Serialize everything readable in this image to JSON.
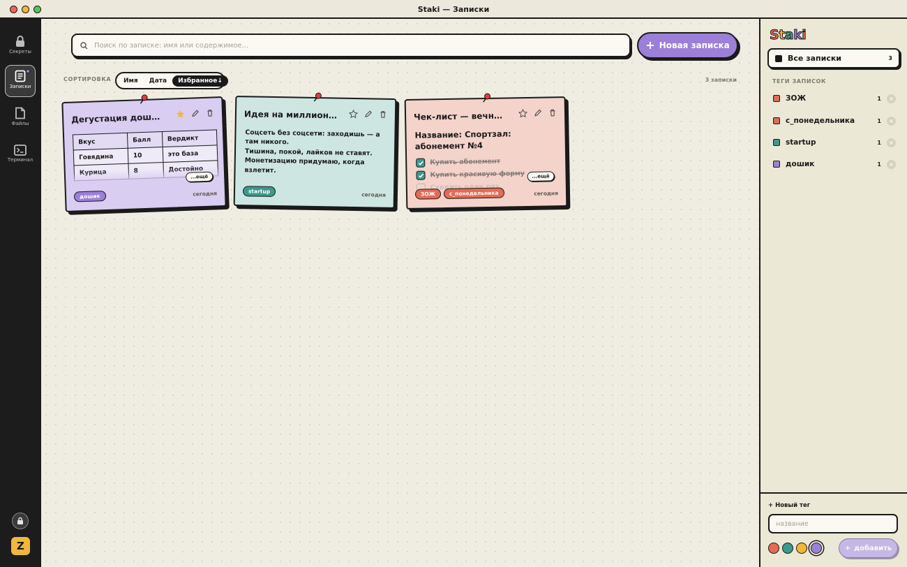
{
  "window": {
    "title": "Staki — Записки"
  },
  "rail": {
    "items": [
      {
        "label": "Секреты",
        "icon": "lock-icon"
      },
      {
        "label": "Записки",
        "icon": "note-icon"
      },
      {
        "label": "Файлы",
        "icon": "file-icon"
      },
      {
        "label": "Терминал",
        "icon": "terminal-icon"
      }
    ],
    "avatar_letter": "Z"
  },
  "search": {
    "placeholder": "Поиск по записке: имя или содержимое..."
  },
  "new_note_button": "Новая записка",
  "sort": {
    "label": "СОРТИРОВКА",
    "options": [
      "Имя",
      "Дата",
      "Избранное↓"
    ],
    "active": "Избранное↓"
  },
  "notes_count": "3 записки",
  "notes": [
    {
      "title": "Дегустация доширака",
      "favorite": true,
      "table": {
        "headers": [
          "Вкус",
          "Балл",
          "Вердикт"
        ],
        "rows": [
          [
            "Говядина",
            "10",
            "это база"
          ],
          [
            "Курица",
            "8",
            "Достойно"
          ]
        ]
      },
      "more_label": "...ещё",
      "tags": [
        "дошик"
      ],
      "date": "сегодня"
    },
    {
      "title": "Идея на миллион",
      "emoji": "💡",
      "favorite": false,
      "body": [
        "Соцсеть без соцсети: заходишь — а там никого.",
        "Тишина, покой, лайков не ставят.",
        "Монетизацию придумаю, когда взлетит."
      ],
      "tags": [
        "startup"
      ],
      "date": "сегодня"
    },
    {
      "title": "Чек-лист — вечное обещание",
      "favorite": false,
      "heading": "Название: Спортзал: абонемент №4",
      "checklist": [
        {
          "text": "Купить абонемент",
          "done": true
        },
        {
          "text": "Купить красивую форму",
          "done": true
        },
        {
          "text": "Сходить один раз",
          "done": false
        }
      ],
      "more_label": "...ещё",
      "tags": [
        "ЗОЖ",
        "с_понедельника"
      ],
      "date": "сегодня"
    }
  ],
  "sidebar": {
    "logo": "Staki",
    "all_notes": {
      "label": "Все записки",
      "count": "3"
    },
    "tags_heading": "ТЕГИ ЗАПИСОК",
    "tags": [
      {
        "name": "ЗОЖ",
        "count": "1",
        "color": "#e46a54"
      },
      {
        "name": "с_понедельника",
        "count": "1",
        "color": "#e46a54"
      },
      {
        "name": "startup",
        "count": "1",
        "color": "#3a9a8d"
      },
      {
        "name": "дошик",
        "count": "1",
        "color": "#9b7fd8"
      }
    ],
    "new_tag": {
      "label": "+ Новый тег",
      "placeholder": "название",
      "colors": [
        "#e46a54",
        "#3a9a8d",
        "#f0b73d",
        "#9b7fd8"
      ],
      "selected_color": "#9b7fd8",
      "add_button": "добавить"
    }
  },
  "colors": {
    "accent": "#9b7fd8",
    "teal": "#3a9a8d",
    "coral": "#e46a54",
    "yellow": "#f0b73d"
  }
}
